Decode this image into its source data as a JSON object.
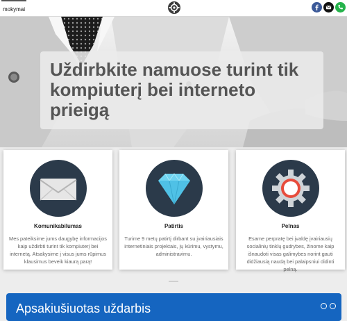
{
  "header": {
    "nav_tab_label": "mokymai",
    "logo_icon": "gear-logo-icon",
    "social_icons": [
      "facebook-icon",
      "email-icon",
      "phone-icon"
    ]
  },
  "hero": {
    "title": "Uždirbkite namuose turint tik kompiuterį bei interneto prieigą"
  },
  "cards": [
    {
      "icon": "envelope-icon",
      "title": "Komunikabilumas",
      "text": "Mes pateiksime jums daugybę informacijos kaip uždirbti turint tik kompiuterį bei internetą. Atsakysime į visus jums rūpimus klausimus beveik kiaurą parą!"
    },
    {
      "icon": "diamond-icon",
      "title": "Patirtis",
      "text": "Turime 9 metų patirtį dirbant su įvairiausiais internetiniais projektais, jų kūrimu, vystymu, administravimu."
    },
    {
      "icon": "gear-icon",
      "title": "Pelnas",
      "text": "Esame perpratę bei įvaldę įvairiausių socialinių tinklų gudrybes, žinome kaip išnaudoti visas galimybes norint gauti didžiausią naudą bei palaipsniui didinti pelną."
    }
  ],
  "panel": {
    "title": "Apsakiušiuotas uždarbis"
  },
  "colors": {
    "circle": "#2b3a4a",
    "panel": "#1565c0",
    "facebook": "#3b5998",
    "phone": "#25b34b"
  }
}
